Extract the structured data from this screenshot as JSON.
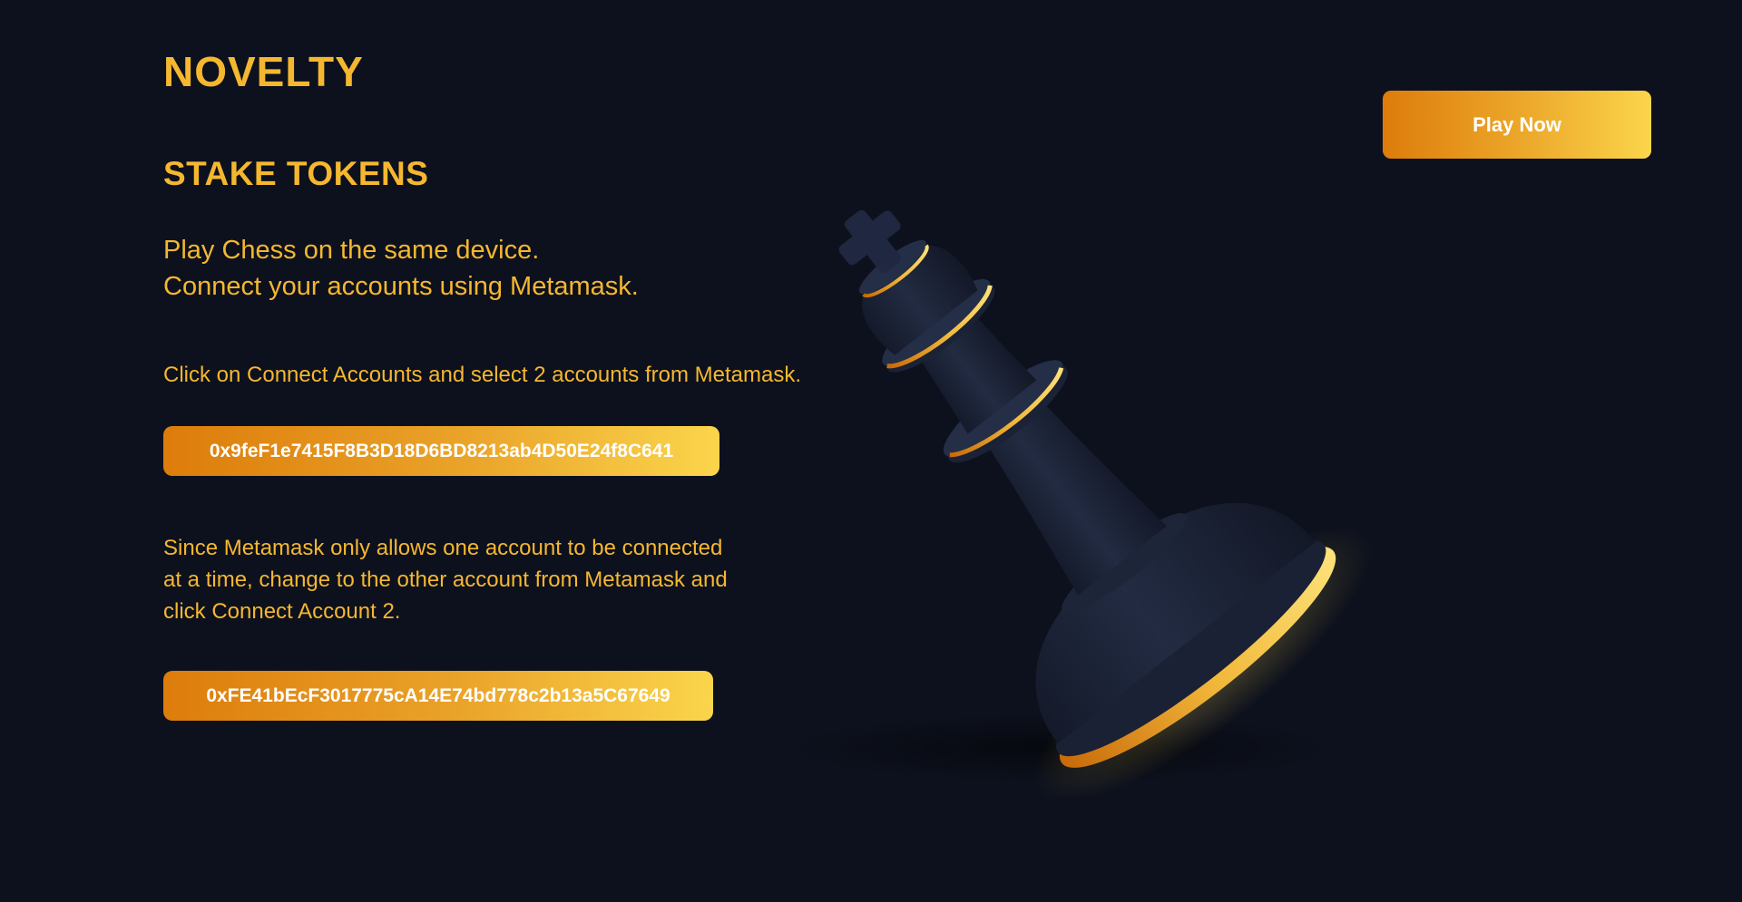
{
  "brand": {
    "logo_text": "NOVELTY"
  },
  "header": {
    "play_now_label": "Play Now"
  },
  "main": {
    "heading": "STAKE TOKENS",
    "intro_line_1": "Play Chess on the same device.",
    "intro_line_2": "Connect your accounts using Metamask.",
    "instruction": "Click on Connect Accounts and select 2 accounts from Metamask.",
    "account_1": "0x9feF1e7415F8B3D18D6BD8213ab4D50E24f8C641",
    "instruction_2": "Since Metamask only allows one account to be connected at a time, change to the other account from Metamask and click Connect Account 2.",
    "account_2": "0xFE41bEcF3017775cA14E74bd778c2b13a5C67649"
  },
  "illustration": {
    "icon": "chess-king-icon"
  },
  "colors": {
    "background": "#0d111d",
    "accent": "#f5b730",
    "gradient_start": "#dd7c0b",
    "gradient_end": "#fbd54c",
    "piece_body": "#1c2438"
  }
}
